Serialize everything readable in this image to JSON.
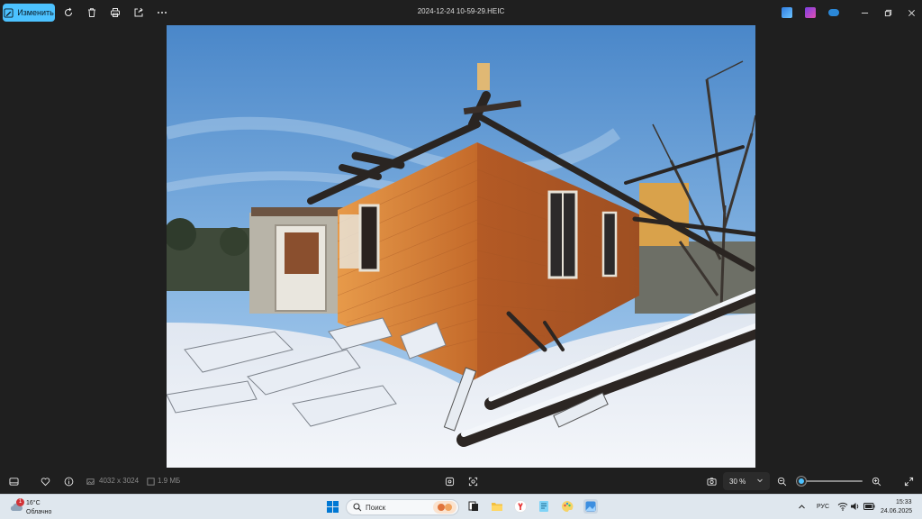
{
  "window": {
    "title": "2024-12-24 10-59-29.HEIC"
  },
  "toolbar": {
    "edit_label": "Изменить",
    "icons": [
      "edit-icon",
      "rotate-icon",
      "delete-icon",
      "print-icon",
      "share-icon",
      "more-icon"
    ]
  },
  "status": {
    "dimensions": "4032 x 3024",
    "file_size": "1.9 МБ",
    "zoom": "30 %",
    "zoom_level_fraction": 0.08
  },
  "taskbar": {
    "weather_temp": "16°C",
    "weather_condition": "Облачно",
    "weather_badge": "1",
    "search_placeholder": "Поиск",
    "language": "РУС",
    "time": "15:33",
    "date": "24.06.2025"
  },
  "colors": {
    "accent": "#4cc2ff",
    "background": "#1f1f1f",
    "taskbar": "#dfe7ee"
  }
}
